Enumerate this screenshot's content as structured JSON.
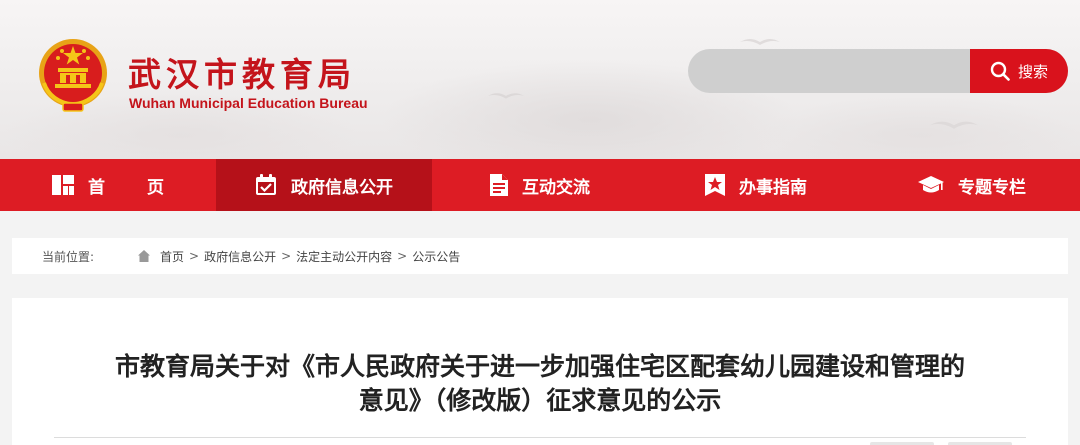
{
  "header": {
    "title": "武汉市教育局",
    "subtitle": "Wuhan Municipal Education Bureau",
    "brand_color": "#c4141b",
    "emblem_icon": "national-emblem-icon"
  },
  "search": {
    "placeholder": "",
    "button_label": "搜索",
    "icon": "search-icon",
    "button_color": "#d9121c"
  },
  "nav": {
    "color": "#dd1c24",
    "active_color": "#b51119",
    "items": [
      {
        "label": "首页",
        "icon": "grid-icon",
        "active": false
      },
      {
        "label": "政府信息公开",
        "icon": "calendar-check-icon",
        "active": true
      },
      {
        "label": "互动交流",
        "icon": "document-icon",
        "active": false
      },
      {
        "label": "办事指南",
        "icon": "star-badge-icon",
        "active": false
      },
      {
        "label": "专题专栏",
        "icon": "graduation-cap-icon",
        "active": false
      }
    ]
  },
  "breadcrumb": {
    "label": "当前位置:",
    "home_icon": "home-icon",
    "items": [
      "首页",
      "政府信息公开",
      "法定主动公开内容",
      "公示公告"
    ],
    "separator": ">"
  },
  "article": {
    "title_line1": "市教育局关于对《市人民政府关于进一步加强住宅区配套幼儿园建设和管理的",
    "title_line2": "意见》（修改版）征求意见的公示"
  }
}
